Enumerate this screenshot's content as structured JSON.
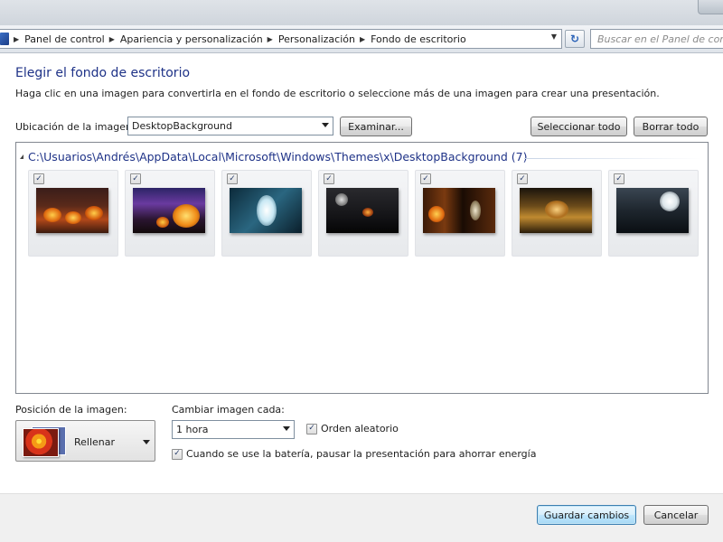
{
  "breadcrumb": {
    "items": [
      "Panel de control",
      "Apariencia y personalización",
      "Personalización",
      "Fondo de escritorio"
    ]
  },
  "search": {
    "placeholder": "Buscar en el Panel de control"
  },
  "page": {
    "title": "Elegir el fondo de escritorio",
    "description": "Haga clic en una imagen para convertirla en el fondo de escritorio o seleccione más de una imagen para crear una presentación."
  },
  "location": {
    "label": "Ubicación de la imagen:",
    "value": "DesktopBackground",
    "browse_label": "Examinar...",
    "select_all_label": "Seleccionar todo",
    "clear_all_label": "Borrar todo"
  },
  "gallery": {
    "group_header": "C:\\Usuarios\\Andrés\\AppData\\Local\\Microsoft\\Windows\\Themes\\x\\DesktopBackground (7)",
    "images": [
      {
        "checked": true,
        "theme": "pumpkins-on-boards"
      },
      {
        "checked": true,
        "theme": "jack-o-lantern-purple-sky"
      },
      {
        "checked": true,
        "theme": "ghost-blue"
      },
      {
        "checked": true,
        "theme": "dark-haunted-house"
      },
      {
        "checked": true,
        "theme": "haunted-doorway"
      },
      {
        "checked": true,
        "theme": "sepia-graveyard"
      },
      {
        "checked": true,
        "theme": "full-moon-night"
      }
    ]
  },
  "position": {
    "label": "Posición de la imagen:",
    "value": "Rellenar"
  },
  "interval": {
    "label": "Cambiar imagen cada:",
    "value": "1 hora"
  },
  "shuffle": {
    "label": "Orden aleatorio",
    "checked": true
  },
  "battery": {
    "label": "Cuando se use la batería, pausar la presentación para ahorrar energía",
    "checked": true
  },
  "footer": {
    "save_label": "Guardar cambios",
    "cancel_label": "Cancelar"
  },
  "colors": {
    "title_blue": "#1e3287",
    "primary_button_border": "#3c7fb1"
  }
}
